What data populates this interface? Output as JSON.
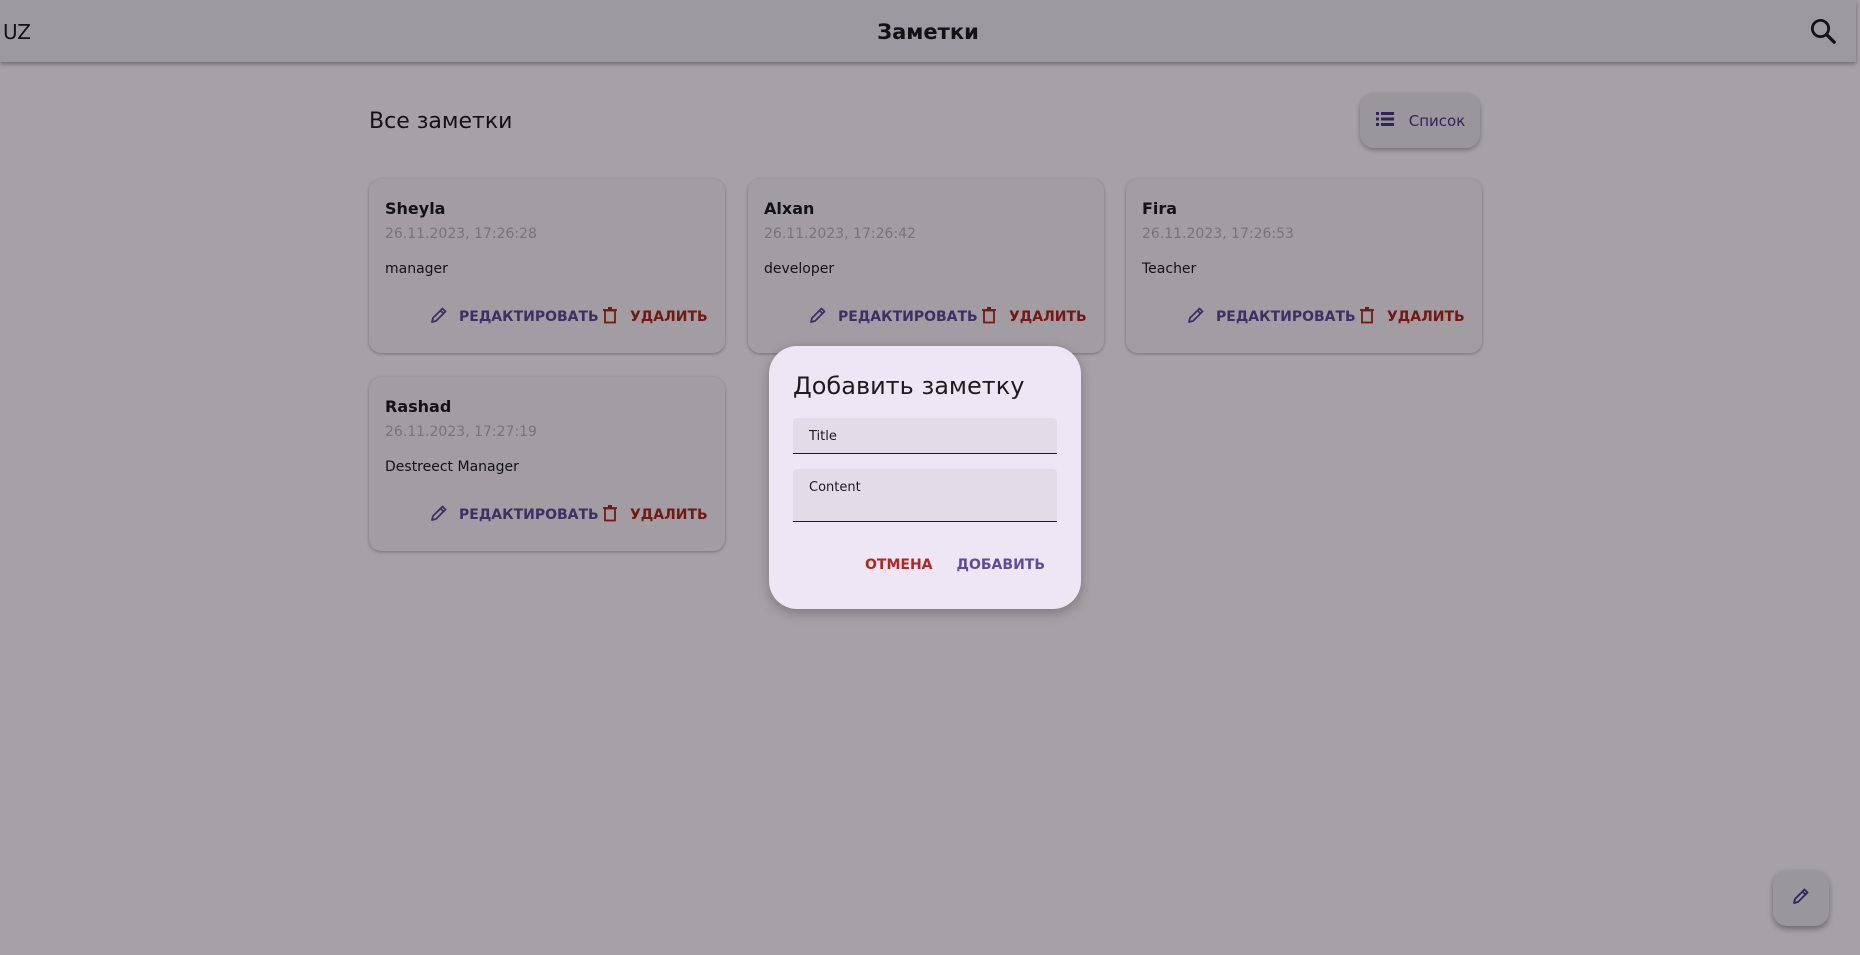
{
  "appbar": {
    "lang": "UZ",
    "title": "Заметки",
    "search_icon": "search-icon"
  },
  "main": {
    "section_title": "Все заметки",
    "view_toggle_label": "Список",
    "view_toggle_icon": "list-icon"
  },
  "notes": [
    {
      "title": "Sheyla",
      "date": "26.11.2023, 17:26:28",
      "content": "manager",
      "edit_label": "РЕДАКТИРОВАТЬ",
      "delete_label": "УДАЛИТЬ"
    },
    {
      "title": "Alxan",
      "date": "26.11.2023, 17:26:42",
      "content": "developer",
      "edit_label": "РЕДАКТИРОВАТЬ",
      "delete_label": "УДАЛИТЬ"
    },
    {
      "title": "Fira",
      "date": "26.11.2023, 17:26:53",
      "content": "Teacher",
      "edit_label": "РЕДАКТИРОВАТЬ",
      "delete_label": "УДАЛИТЬ"
    },
    {
      "title": "Rashad",
      "date": "26.11.2023, 17:27:19",
      "content": "Destreect Manager",
      "edit_label": "РЕДАКТИРОВАТЬ",
      "delete_label": "УДАЛИТЬ"
    }
  ],
  "dialog": {
    "title": "Добавить заметку",
    "title_field_label": "Title",
    "content_field_label": "Content",
    "cancel_label": "ОТМЕНА",
    "add_label": "ДОБАВИТЬ"
  },
  "fab_icon": "pencil-icon",
  "colors": {
    "primary": "#5f4a9c",
    "error": "#b3261e",
    "surface": "#f7f2fa",
    "appbar": "#f2ecf8"
  }
}
